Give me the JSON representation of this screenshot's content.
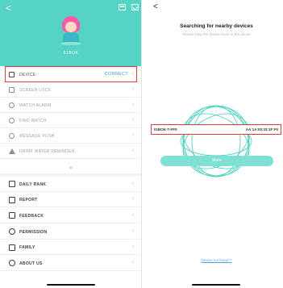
{
  "left": {
    "header": {
      "back": "<",
      "device_name": "01BOK",
      "accent": "#55d3c4"
    },
    "menu1": [
      {
        "label": "DEVICE",
        "value": "CONNECT",
        "icon": "watch-square-icon"
      },
      {
        "label": "SCREEN LOCK",
        "icon": "lock-icon"
      },
      {
        "label": "WATCH ALARM",
        "icon": "alarm-icon"
      },
      {
        "label": "FIND WATCH",
        "icon": "search-icon"
      },
      {
        "label": "MESSAGE PUSH",
        "icon": "message-icon"
      },
      {
        "label": "DRINK WATER REMINDER",
        "icon": "drink-icon"
      }
    ],
    "expand_glyph": "»",
    "menu2": [
      {
        "label": "DAILY RANK",
        "icon": "chart-icon"
      },
      {
        "label": "REPORT",
        "icon": "report-icon"
      },
      {
        "label": "FEEDBACK",
        "icon": "feedback-icon"
      },
      {
        "label": "PERMISSION",
        "icon": "shield-icon"
      },
      {
        "label": "FAMILY",
        "icon": "home-icon"
      },
      {
        "label": "ABOUT US",
        "icon": "info-icon"
      }
    ]
  },
  "right": {
    "back": "<",
    "title": "Searching for nearby devices",
    "subtitle": "Please keep the device close to the phone",
    "device": {
      "name": "01BOK-T-FF0",
      "mac": "AA:1A:00:33:1F:F0"
    },
    "more_label": "More",
    "not_found": "Device not found ?",
    "highlight_color": "#e0393e"
  }
}
